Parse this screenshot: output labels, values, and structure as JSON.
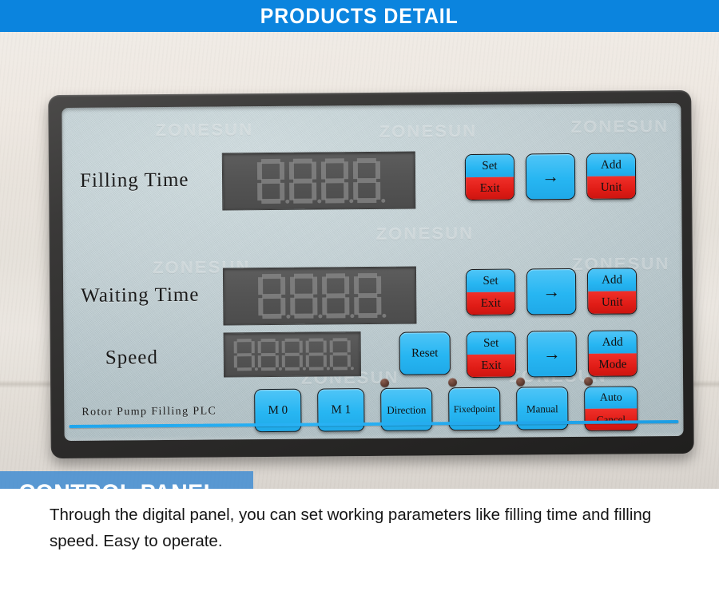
{
  "top_banner": {
    "title": "PRODUCTS DETAIL",
    "bg_color": "#0b84de",
    "text_color": "#ffffff"
  },
  "overlay_tag": {
    "label": "CONTROL PANEL",
    "bg_color": "#3c8ad2",
    "text_color": "#ffffff"
  },
  "caption": {
    "text": "Through the digital panel, you can set working parameters like filling time and filling speed. Easy to operate."
  },
  "panel": {
    "brand_watermark": "ZONESUN",
    "model_label": "Rotor Pump Filling PLC",
    "bezel_color": "#2c2b2a",
    "face_color": "#c6d4d8",
    "accent_stripe_color": "#29b2f4",
    "button_blue": "#27b6f2",
    "button_red": "#e01c16",
    "display_bg": "#545454",
    "segment_color": "#8b8b8b",
    "rows": [
      {
        "label": "Filling Time",
        "display": {
          "digits": 4,
          "decimal_points": true,
          "value": ""
        },
        "buttons": [
          {
            "name": "set-exit",
            "top": "Set",
            "bottom": "Exit",
            "style": "split"
          },
          {
            "name": "arrow",
            "glyph": "→",
            "style": "solid"
          },
          {
            "name": "add-unit",
            "top": "Add",
            "bottom": "Unit",
            "style": "split"
          }
        ]
      },
      {
        "label": "Waiting Time",
        "display": {
          "digits": 4,
          "decimal_points": true,
          "value": ""
        },
        "buttons": [
          {
            "name": "set-exit",
            "top": "Set",
            "bottom": "Exit",
            "style": "split"
          },
          {
            "name": "arrow",
            "glyph": "→",
            "style": "solid"
          },
          {
            "name": "add-unit",
            "top": "Add",
            "bottom": "Unit",
            "style": "split"
          }
        ]
      },
      {
        "label": "Speed",
        "display": {
          "digits": 5,
          "decimal_points": true,
          "value": ""
        },
        "buttons": [
          {
            "name": "reset",
            "top": "Reset",
            "style": "solid"
          },
          {
            "name": "set-exit",
            "top": "Set",
            "bottom": "Exit",
            "style": "split"
          },
          {
            "name": "arrow",
            "glyph": "→",
            "style": "solid"
          },
          {
            "name": "add-mode",
            "top": "Add",
            "bottom": "Mode",
            "style": "split"
          }
        ]
      }
    ],
    "mode_buttons": [
      {
        "name": "m0",
        "top": "M 0",
        "style": "solid",
        "led": false
      },
      {
        "name": "m1",
        "top": "M 1",
        "style": "solid",
        "led": false
      },
      {
        "name": "direction",
        "top": "Direction",
        "style": "solid",
        "led": true
      },
      {
        "name": "fixedpoint",
        "top": "Fixedpoint",
        "style": "solid",
        "led": true
      },
      {
        "name": "manual",
        "top": "Manual",
        "style": "solid",
        "led": true
      },
      {
        "name": "auto-cancel",
        "top": "Auto",
        "bottom": "Cancel",
        "style": "split",
        "led": true
      }
    ]
  }
}
